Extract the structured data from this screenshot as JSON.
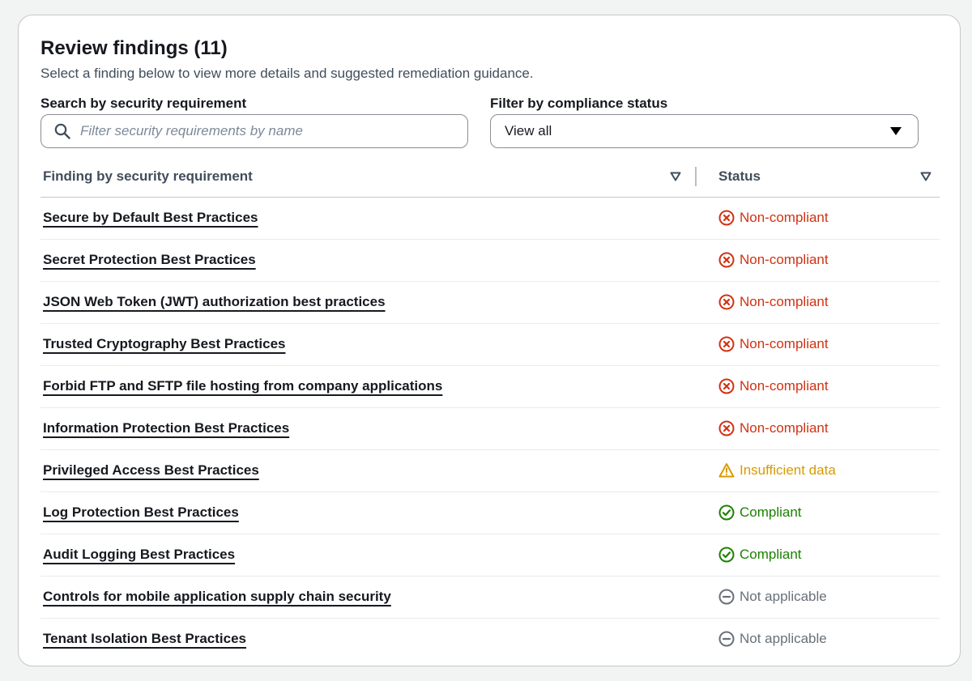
{
  "panel": {
    "title": "Review findings (11)",
    "subtitle": "Select a finding below to view more details and suggested remediation guidance."
  },
  "search": {
    "label": "Search by security requirement",
    "placeholder": "Filter security requirements by name",
    "value": "",
    "icon": "search-icon"
  },
  "filter": {
    "label": "Filter by compliance status",
    "selected": "View all",
    "icon": "caret-down-icon"
  },
  "table": {
    "columns": [
      {
        "label": "Finding by security requirement",
        "sort_icon": "sort-descending-icon"
      },
      {
        "label": "Status",
        "sort_icon": "sort-descending-icon"
      }
    ],
    "rows": [
      {
        "name": "Secure by Default Best Practices",
        "status": "Non-compliant",
        "status_type": "non-compliant"
      },
      {
        "name": "Secret Protection Best Practices",
        "status": "Non-compliant",
        "status_type": "non-compliant"
      },
      {
        "name": "JSON Web Token (JWT) authorization best practices",
        "status": "Non-compliant",
        "status_type": "non-compliant"
      },
      {
        "name": "Trusted Cryptography Best Practices",
        "status": "Non-compliant",
        "status_type": "non-compliant"
      },
      {
        "name": "Forbid FTP and SFTP file hosting from company applications",
        "status": "Non-compliant",
        "status_type": "non-compliant"
      },
      {
        "name": "Information Protection Best Practices",
        "status": "Non-compliant",
        "status_type": "non-compliant"
      },
      {
        "name": "Privileged Access Best Practices",
        "status": "Insufficient data",
        "status_type": "insufficient"
      },
      {
        "name": "Log Protection Best Practices",
        "status": "Compliant",
        "status_type": "compliant"
      },
      {
        "name": "Audit Logging Best Practices",
        "status": "Compliant",
        "status_type": "compliant"
      },
      {
        "name": "Controls for mobile application supply chain security",
        "status": "Not applicable",
        "status_type": "not-applicable"
      },
      {
        "name": "Tenant Isolation Best Practices",
        "status": "Not applicable",
        "status_type": "not-applicable"
      }
    ]
  },
  "status_styles": {
    "non-compliant": {
      "color": "#d13212",
      "icon": "x-circle-icon"
    },
    "insufficient": {
      "color": "#d79b00",
      "icon": "warning-triangle-icon"
    },
    "compliant": {
      "color": "#1d8102",
      "icon": "check-circle-icon"
    },
    "not-applicable": {
      "color": "#687078",
      "icon": "minus-circle-icon"
    }
  }
}
